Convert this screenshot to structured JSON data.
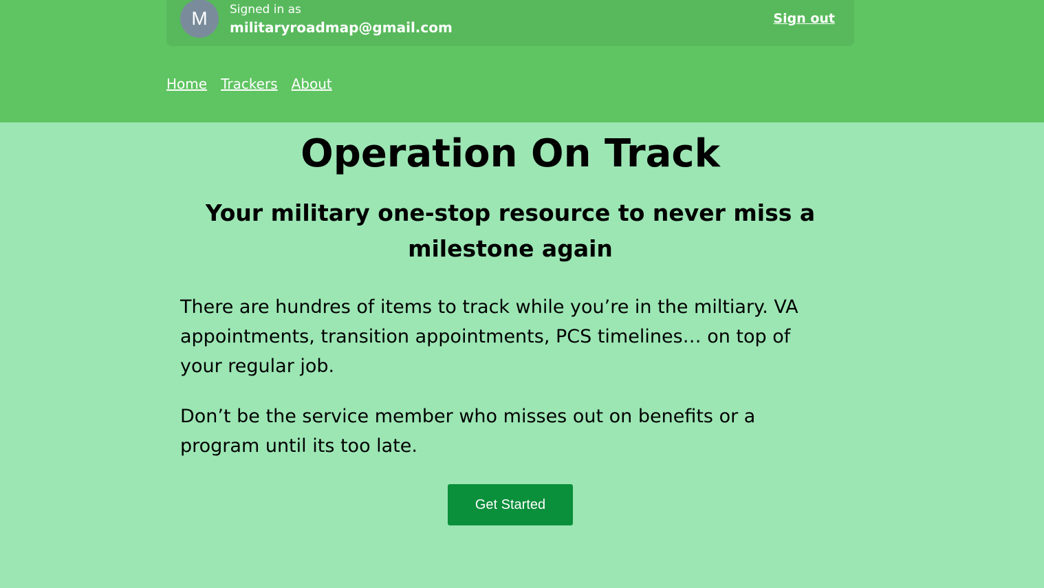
{
  "account": {
    "avatar_initial": "M",
    "signed_in_label": "Signed in as",
    "email": "militaryroadmap@gmail.com",
    "sign_out_label": "Sign out"
  },
  "nav": {
    "items": [
      {
        "label": "Home"
      },
      {
        "label": "Trackers"
      },
      {
        "label": "About"
      }
    ]
  },
  "hero": {
    "title": "Operation On Track",
    "subtitle": "Your military one-stop resource to never miss a milestone again",
    "paragraphs": [
      "There are hundres of items to track while you’re in the miltiary. VA appointments, transition appointments, PCS timelines… on top of your regular job.",
      "Don’t be the service member who misses out on benefits or a program until its too late."
    ],
    "cta_label": "Get Started"
  },
  "colors": {
    "header_bg": "#5fc462",
    "signin_bar_bg": "#58b95c",
    "page_bg": "#9ce6b4",
    "cta_bg": "#0a8f3b",
    "avatar_bg": "#7a8c9b"
  }
}
